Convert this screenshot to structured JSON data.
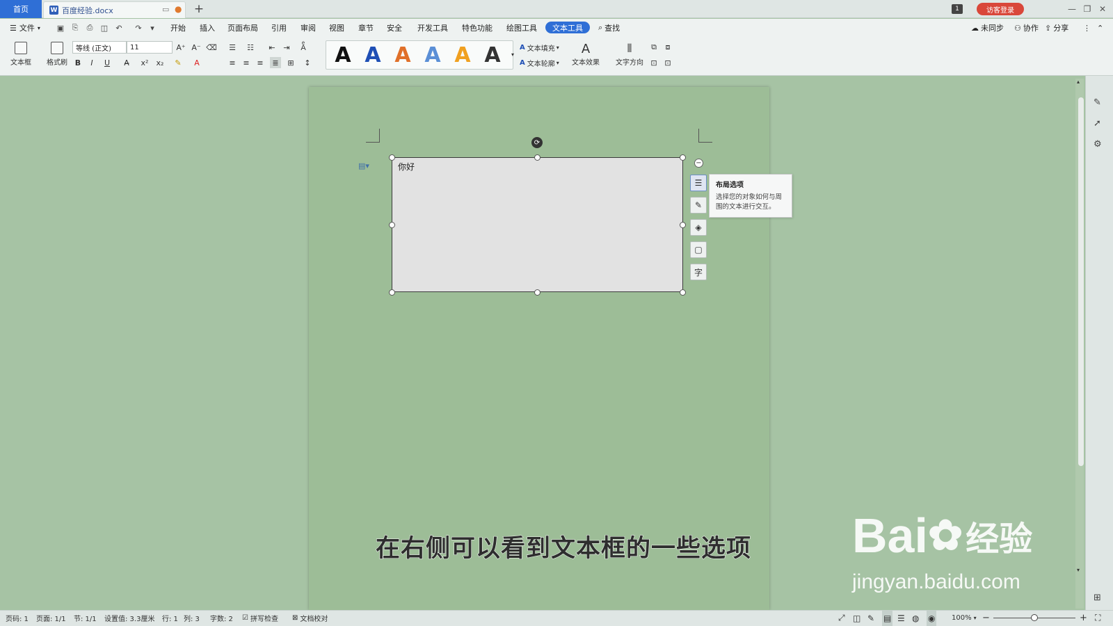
{
  "tabs": {
    "home": "首页",
    "doc_title": "百度经验.docx",
    "new_tab": "+",
    "window_badge": "1",
    "login": "访客登录"
  },
  "menu": {
    "file": "文件",
    "items": [
      "开始",
      "插入",
      "页面布局",
      "引用",
      "审阅",
      "视图",
      "章节",
      "安全",
      "开发工具",
      "特色功能",
      "绘图工具"
    ],
    "active": "文本工具",
    "search": "查找",
    "right": {
      "sync": "未同步",
      "collab": "协作",
      "share": "分享"
    }
  },
  "ribbon": {
    "textbox": "文本框",
    "format_painter": "格式刷",
    "font_name": "等线 (正文)",
    "font_size": "11",
    "bold": "B",
    "italic": "I",
    "underline": "U",
    "text_fill": "文本填充",
    "text_outline": "文本轮廓",
    "text_effect": "文本效果",
    "text_direction": "文字方向",
    "style_gallery": [
      {
        "glyph": "A",
        "color": "#111111"
      },
      {
        "glyph": "A",
        "color": "#1f4fb5"
      },
      {
        "glyph": "A",
        "color": "#e0702a"
      },
      {
        "glyph": "A",
        "color": "#5b8fd6"
      },
      {
        "glyph": "A",
        "color": "#f0a020"
      },
      {
        "glyph": "A",
        "color": "#333333"
      }
    ]
  },
  "document": {
    "textbox_text": "你好",
    "tooltip_title": "布局选项",
    "tooltip_desc": "选择您的对象如何与周围的文本进行交互。",
    "side_char_button": "字",
    "caption": "在右侧可以看到文本框的一些选项"
  },
  "watermark": {
    "brand": "Bai",
    "brand2": "经验",
    "url": "jingyan.baidu.com"
  },
  "status": {
    "page_num": "页码: 1",
    "pages": "页面: 1/1",
    "section": "节: 1/1",
    "setting": "设置值: 3.3厘米",
    "row": "行: 1",
    "col": "列: 3",
    "words": "字数: 2",
    "spell": "拼写检查",
    "proof": "文档校对",
    "zoom": "100%"
  }
}
